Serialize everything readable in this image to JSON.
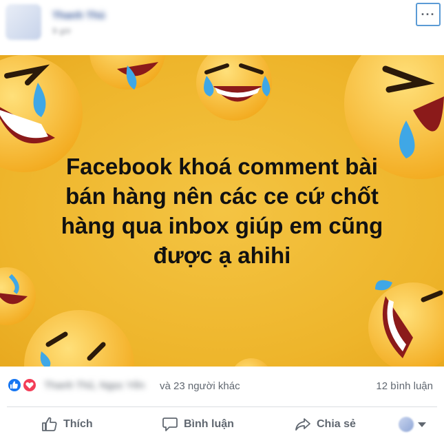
{
  "post": {
    "author_name": "Thanh Thủ",
    "time": "9 giờ",
    "more_label": "···",
    "headline_lines": [
      "Facebook khoá comment bài",
      "bán hàng nên các ce cứ chốt",
      "hàng qua inbox giúp em cũng",
      "được ạ ahihi"
    ]
  },
  "reactions": {
    "names": "Thanh Thủ, Ngọc Yến",
    "others": "và 23 người khác",
    "comments": "12 bình luận",
    "icons": [
      "like-icon",
      "love-icon"
    ]
  },
  "actions": {
    "like": "Thích",
    "comment": "Bình luận",
    "share": "Chia sẻ"
  },
  "colors": {
    "background_yellow": "#eeb52b",
    "like_blue": "#1877f2",
    "love_red": "#f33e58",
    "link_blue": "#385898"
  }
}
